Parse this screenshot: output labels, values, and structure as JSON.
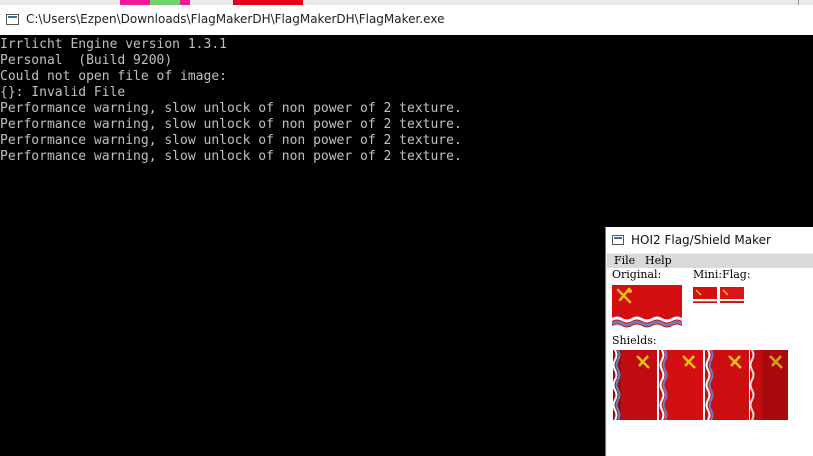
{
  "console": {
    "title": "C:\\Users\\Ezpen\\Downloads\\FlagMakerDH\\FlagMakerDH\\FlagMaker.exe",
    "lines": [
      "Irrlicht Engine version 1.3.1",
      "Personal  (Build 9200)",
      "Could not open file of image:",
      "{}: Invalid File",
      "Performance warning, slow unlock of non power of 2 texture.",
      "Performance warning, slow unlock of non power of 2 texture.",
      "Performance warning, slow unlock of non power of 2 texture.",
      "Performance warning, slow unlock of non power of 2 texture."
    ]
  },
  "flag_maker": {
    "title": "HOI2 Flag/Shield Maker",
    "menu": {
      "file": "File",
      "help": "Help"
    },
    "labels": {
      "original": "Original:",
      "mini_flag": "Mini:Flag:",
      "shields": "Shields:"
    },
    "colors": {
      "flag_red": "#d40f12",
      "emblem_gold": "#e8c21a",
      "wave_blue": "#5a86c8"
    }
  }
}
